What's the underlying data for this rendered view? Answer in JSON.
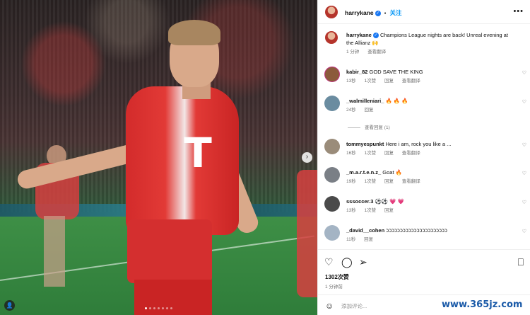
{
  "post": {
    "username": "harrykane",
    "follow_label": "关注",
    "more_icon": "more-horizontal-icon",
    "caption_text": "Champions League nights are back! Unreal evening at the Allianz 🙌",
    "caption_time": "1 分钟",
    "see_translation": "查看翻译"
  },
  "comments": [
    {
      "user": "kabir_82",
      "text": "GOD SAVE THE KING",
      "time": "13秒",
      "likes": "1次赞",
      "reply": "回复",
      "translate": "查看翻译",
      "avatar_color": "#8b5a3c"
    },
    {
      "user": "_walmilleniari_",
      "text": "🔥 🔥 🔥",
      "time": "24秒",
      "likes": "",
      "reply": "回复",
      "translate": "",
      "avatar_color": "#6a8ca0"
    },
    {
      "user": "tommyespunkt",
      "text": "Here i am, rock you like a ...",
      "time": "16秒",
      "likes": "1次赞",
      "reply": "回复",
      "translate": "查看翻译",
      "avatar_color": "#9a8c7a"
    },
    {
      "user": "_m.a.r.t.e.n.z_",
      "text": "Goat 🔥",
      "time": "19秒",
      "likes": "1次赞",
      "reply": "回复",
      "translate": "查看翻译",
      "avatar_color": "#7a7f86"
    },
    {
      "user": "sssoccer.3",
      "text": "⚽⚽ 💗 💗",
      "time": "13秒",
      "likes": "1次赞",
      "reply": "回复",
      "translate": "",
      "avatar_color": "#4a4a4a"
    },
    {
      "user": "_david__cohen",
      "text": "ככככככככככככככככככככככ",
      "time": "11秒",
      "likes": "",
      "reply": "回复",
      "translate": "",
      "avatar_color": "#a4b4c4"
    }
  ],
  "view_replies": "查看回复 (1)",
  "actions": {
    "like_icon": "heart-icon",
    "comment_icon": "comment-icon",
    "share_icon": "send-icon",
    "save_icon": "bookmark-icon"
  },
  "likes_count": "1302次赞",
  "post_time": "1 分钟前",
  "comment_placeholder": "添加评论...",
  "watermark": "www.365jz.com",
  "colors": {
    "accent": "#0095f6",
    "verified": "#1877f2",
    "kit_red": "#d32b2b"
  }
}
